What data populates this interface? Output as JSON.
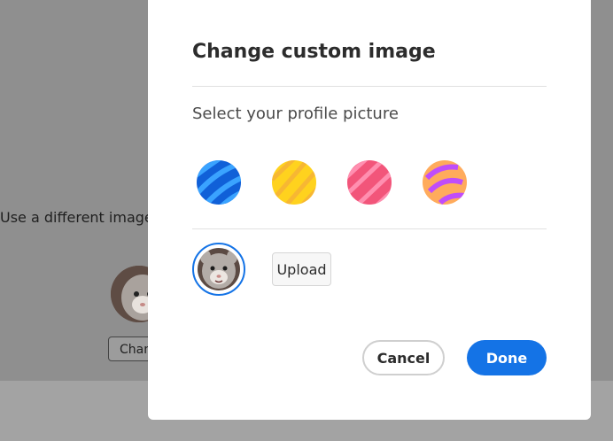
{
  "background": {
    "text": "Use a different image or",
    "change_button_label": "Chang"
  },
  "dialog": {
    "title": "Change custom image",
    "subtitle": "Select your profile picture",
    "swatches": [
      {
        "name": "blue",
        "color": "#1473e6"
      },
      {
        "name": "yellow",
        "color": "#ffd21e"
      },
      {
        "name": "pink",
        "color": "#f2557a"
      },
      {
        "name": "purple-orange",
        "color": "#c04dfa"
      }
    ],
    "upload_label": "Upload",
    "cancel_label": "Cancel",
    "done_label": "Done"
  },
  "colors": {
    "accent": "#1473e6"
  }
}
